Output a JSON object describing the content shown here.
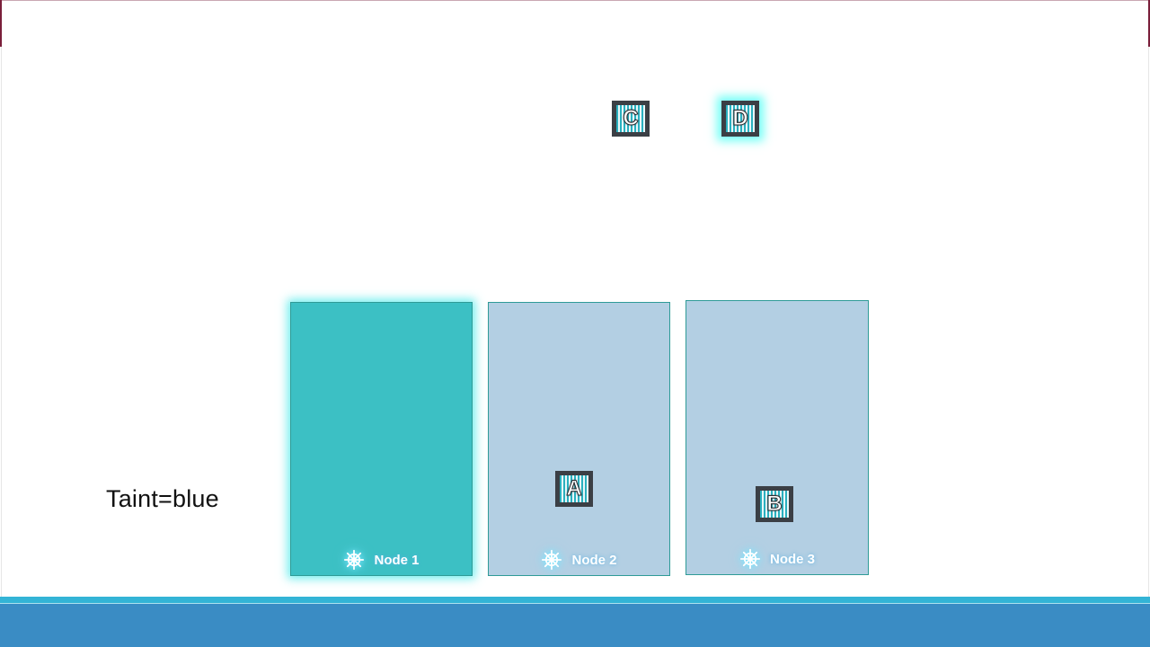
{
  "taint_label": "Taint=blue",
  "nodes": [
    {
      "name": "Node 1",
      "icon": "kubernetes-helm-icon",
      "tainted": true
    },
    {
      "name": "Node 2",
      "icon": "kubernetes-helm-icon",
      "tainted": false
    },
    {
      "name": "Node 3",
      "icon": "kubernetes-helm-icon",
      "tainted": false
    }
  ],
  "pods": {
    "a": {
      "label": "A",
      "location": "Node 2"
    },
    "b": {
      "label": "B",
      "location": "Node 3"
    },
    "c": {
      "label": "C",
      "location": "unscheduled"
    },
    "d": {
      "label": "D",
      "location": "unscheduled",
      "highlighted": true
    }
  },
  "colors": {
    "tainted_node": "#3cc0c4",
    "normal_node": "#b3cfe3",
    "node_border": "#2f9b97",
    "pod_frame": "#3b3f45",
    "pod_stripe": "#2ab0bf",
    "footer_bar": "#3a8cc4",
    "footer_accent": "#33b4d6"
  }
}
